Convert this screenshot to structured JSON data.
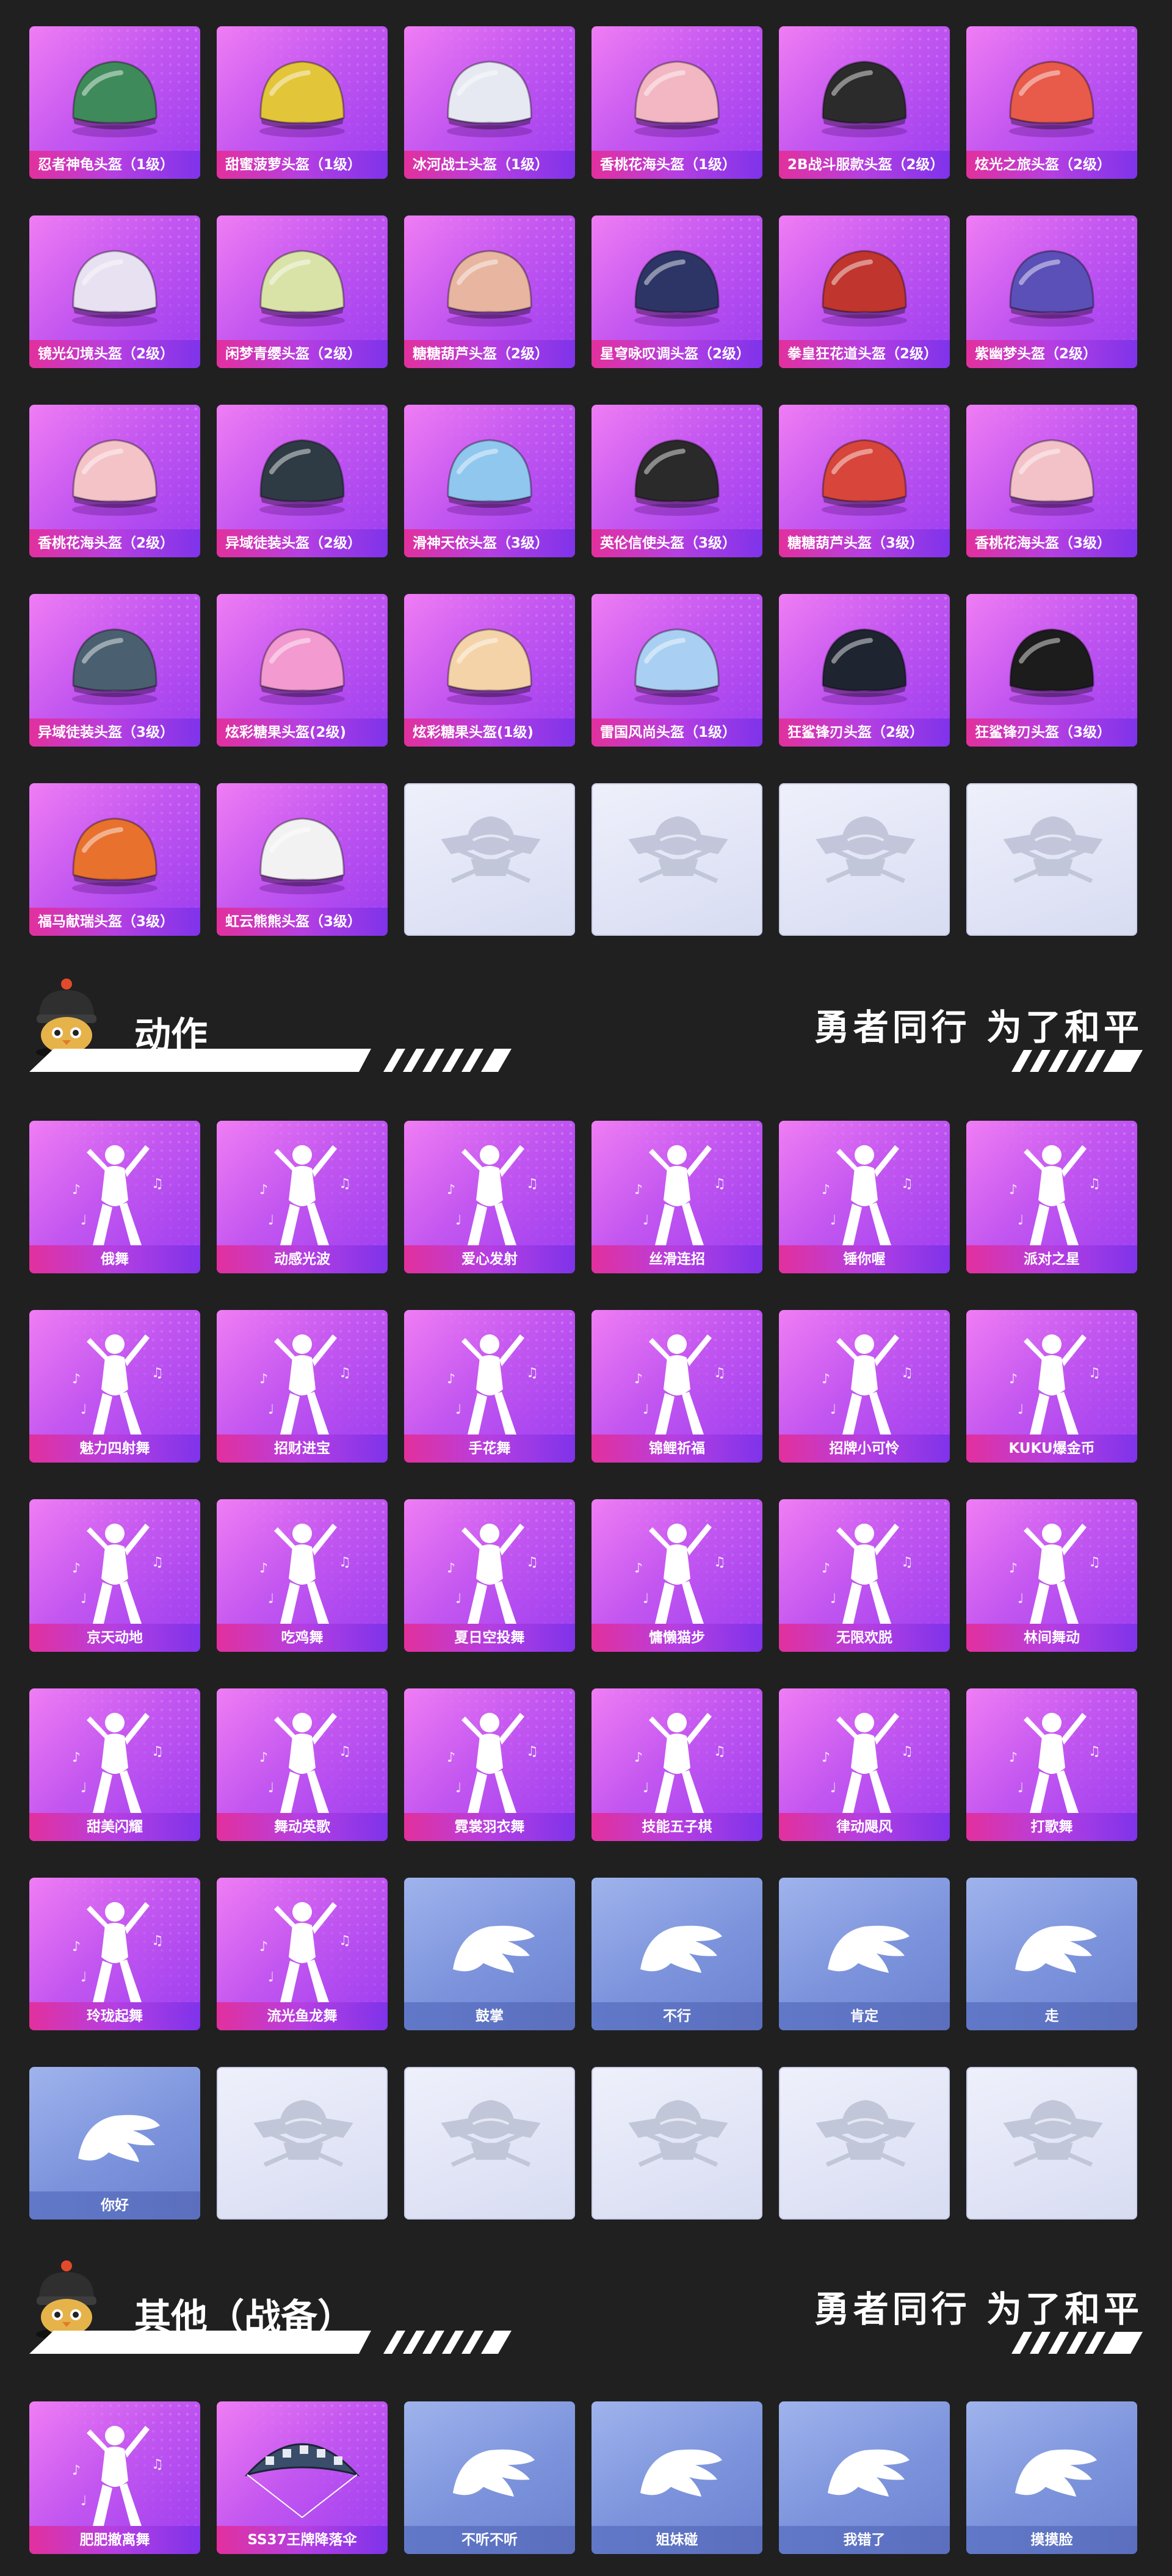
{
  "helmets": {
    "items": [
      {
        "label": "忍者神龟头盔（1级）",
        "kind": "helmet",
        "color": "#3f8a5a"
      },
      {
        "label": "甜蜜菠萝头盔（1级）",
        "kind": "helmet",
        "color": "#e3c53a"
      },
      {
        "label": "冰河战士头盔（1级）",
        "kind": "helmet",
        "color": "#e6e9f2"
      },
      {
        "label": "香桃花海头盔（1级）",
        "kind": "helmet",
        "color": "#f2b7c3"
      },
      {
        "label": "2B战斗服款头盔（2级）",
        "kind": "helmet",
        "color": "#2b2b2b"
      },
      {
        "label": "炫光之旅头盔（2级）",
        "kind": "helmet",
        "color": "#e85a4a"
      },
      {
        "label": "镜光幻境头盔（2级）",
        "kind": "helmet",
        "color": "#e7e1f2"
      },
      {
        "label": "闲梦青缨头盔（2级）",
        "kind": "helmet",
        "color": "#d9e3a8"
      },
      {
        "label": "糖糖葫芦头盔（2级）",
        "kind": "helmet",
        "color": "#e7b5a0"
      },
      {
        "label": "星穹咏叹调头盔（2级）",
        "kind": "helmet",
        "color": "#2d3566"
      },
      {
        "label": "拳皇狂花道头盔（2级）",
        "kind": "helmet",
        "color": "#c0352d"
      },
      {
        "label": "紫幽梦头盔（2级）",
        "kind": "helmet",
        "color": "#5b4fb8"
      },
      {
        "label": "香桃花海头盔（2级）",
        "kind": "helmet",
        "color": "#f4c3c8"
      },
      {
        "label": "异域徒装头盔（2级）",
        "kind": "helmet",
        "color": "#2e3b45"
      },
      {
        "label": "滑神天依头盔（3级）",
        "kind": "helmet",
        "color": "#8fc7ef"
      },
      {
        "label": "英伦信使头盔（3级）",
        "kind": "helmet",
        "color": "#2a2a2a"
      },
      {
        "label": "糖糖葫芦头盔（3级）",
        "kind": "helmet",
        "color": "#d8453a"
      },
      {
        "label": "香桃花海头盔（3级）",
        "kind": "helmet",
        "color": "#f3c2c8"
      },
      {
        "label": "异域徒装头盔（3级）",
        "kind": "helmet",
        "color": "#4a6070"
      },
      {
        "label": "炫彩糖果头盔(2级)",
        "kind": "helmet",
        "color": "#f39ad0"
      },
      {
        "label": "炫彩糖果头盔(1级)",
        "kind": "helmet",
        "color": "#f4d3a8"
      },
      {
        "label": "雷国风尚头盔（1级）",
        "kind": "helmet",
        "color": "#a9d0f2"
      },
      {
        "label": "狂鲨锋刃头盔（2级）",
        "kind": "helmet",
        "color": "#1e2430"
      },
      {
        "label": "狂鲨锋刃头盔（3级）",
        "kind": "helmet",
        "color": "#1c1c1c"
      },
      {
        "label": "福马献瑞头盔（3级）",
        "kind": "helmet",
        "color": "#e8712e"
      },
      {
        "label": "虹云熊熊头盔（3级）",
        "kind": "helmet",
        "color": "#f2f2f2"
      },
      {
        "label": "",
        "kind": "empty"
      },
      {
        "label": "",
        "kind": "empty"
      },
      {
        "label": "",
        "kind": "empty"
      },
      {
        "label": "",
        "kind": "empty"
      }
    ]
  },
  "actions": {
    "title": "动作",
    "slogan": "勇者同行 为了和平",
    "items": [
      {
        "label": "俄舞",
        "kind": "dance"
      },
      {
        "label": "动感光波",
        "kind": "dance"
      },
      {
        "label": "爱心发射",
        "kind": "dance"
      },
      {
        "label": "丝滑连招",
        "kind": "dance"
      },
      {
        "label": "锤你喔",
        "kind": "dance"
      },
      {
        "label": "派对之星",
        "kind": "dance"
      },
      {
        "label": "魅力四射舞",
        "kind": "dance"
      },
      {
        "label": "招财进宝",
        "kind": "dance"
      },
      {
        "label": "手花舞",
        "kind": "dance"
      },
      {
        "label": "锦鲤祈福",
        "kind": "dance"
      },
      {
        "label": "招牌小可怜",
        "kind": "dance"
      },
      {
        "label": "KUKU爆金币",
        "kind": "dance"
      },
      {
        "label": "京天动地",
        "kind": "dance"
      },
      {
        "label": "吃鸡舞",
        "kind": "dance"
      },
      {
        "label": "夏日空投舞",
        "kind": "dance"
      },
      {
        "label": "慵懒猫步",
        "kind": "dance"
      },
      {
        "label": "无限欢脱",
        "kind": "dance"
      },
      {
        "label": "林间舞动",
        "kind": "dance"
      },
      {
        "label": "甜美闪耀",
        "kind": "dance"
      },
      {
        "label": "舞动英歌",
        "kind": "dance"
      },
      {
        "label": "霓裳羽衣舞",
        "kind": "dance"
      },
      {
        "label": "技能五子棋",
        "kind": "dance"
      },
      {
        "label": "律动飓风",
        "kind": "dance"
      },
      {
        "label": "打歌舞",
        "kind": "dance"
      },
      {
        "label": "玲珑起舞",
        "kind": "dance"
      },
      {
        "label": "流光鱼龙舞",
        "kind": "dance"
      },
      {
        "label": "鼓掌",
        "kind": "gesture"
      },
      {
        "label": "不行",
        "kind": "gesture"
      },
      {
        "label": "肯定",
        "kind": "gesture"
      },
      {
        "label": "走",
        "kind": "gesture"
      },
      {
        "label": "你好",
        "kind": "gesture"
      },
      {
        "label": "",
        "kind": "empty"
      },
      {
        "label": "",
        "kind": "empty"
      },
      {
        "label": "",
        "kind": "empty"
      },
      {
        "label": "",
        "kind": "empty"
      },
      {
        "label": "",
        "kind": "empty"
      }
    ]
  },
  "others": {
    "title": "其他（战备）",
    "slogan": "勇者同行 为了和平",
    "items": [
      {
        "label": "肥肥撤离舞",
        "kind": "dance"
      },
      {
        "label": "SS37王牌降落伞",
        "kind": "parachute"
      },
      {
        "label": "不听不听",
        "kind": "gesture"
      },
      {
        "label": "姐妹碰",
        "kind": "gesture"
      },
      {
        "label": "我错了",
        "kind": "gesture"
      },
      {
        "label": "摸摸脸",
        "kind": "gesture"
      }
    ]
  },
  "colors": {
    "background": "#202020",
    "card_purple": "#b84ff0",
    "card_blue": "#7c93dc",
    "card_empty": "#e3e6f6",
    "label_pink": "#e2309d",
    "label_violet": "#7f33ea"
  }
}
